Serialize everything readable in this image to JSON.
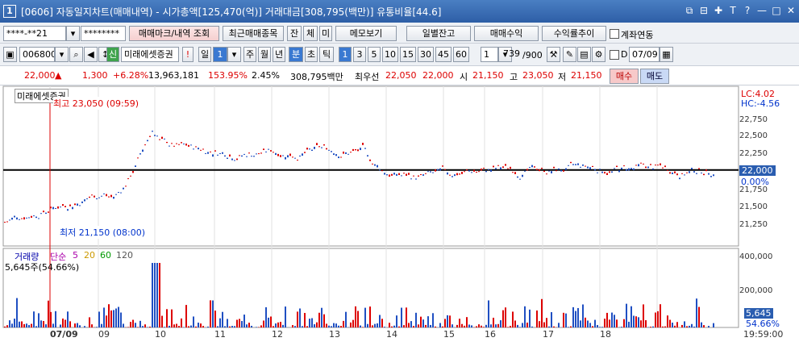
{
  "title": {
    "num": "1",
    "text": "[0606] 자동일지차트(매매내역) - 시가총액[125,470(억)] 거래대금[308,795(백만)] 유통비율[44.6]"
  },
  "toolbar1": {
    "account": "****-**21",
    "password": "********",
    "btn_mark": "매매마크/내역 조회",
    "btn_recent": "최근매매종목",
    "btn_jan": "잔",
    "btn_che": "체",
    "btn_mi": "미",
    "btn_memo": "메모보기",
    "btn_daily": "일별잔고",
    "btn_trade": "매매수익",
    "btn_curve": "수익률추이",
    "chk_link": "계좌연동"
  },
  "toolbar2": {
    "code": "006800",
    "stock": "미래에셋증권",
    "badge": "신",
    "excl": "!",
    "period_day": "일",
    "period_w": "주",
    "period_m": "월",
    "period_y": "년",
    "period_min": "분",
    "period_sec": "초",
    "period_tick": "틱",
    "intervals": [
      "1",
      "3",
      "5",
      "10",
      "15",
      "30",
      "45",
      "60"
    ],
    "interval_val": "1",
    "count": "739",
    "count_total": "/900",
    "date": "07/09",
    "d_label": "D"
  },
  "price": {
    "cur": "22,000",
    "up": "▲",
    "chg": "1,300",
    "pct": "+6.28%",
    "vol": "13,963,181",
    "vol_pct": "153.95%",
    "turn": "2.45%",
    "amount": "308,795백만",
    "best_lbl": "최우선",
    "best_ask": "22,050",
    "best_bid": "22,000",
    "open_lbl": "시",
    "open": "21,150",
    "high_lbl": "고",
    "high": "23,050",
    "low_lbl": "저",
    "low": "21,150",
    "buy": "매수",
    "sell": "매도"
  },
  "chart": {
    "name": "미래에셋증권",
    "high_note": "최고 23,050 (09:59)",
    "low_note": "최저 21,150 (08:00)",
    "lc": "LC:4.02",
    "hc": "HC:-4.56",
    "cur_tag": "22,000",
    "cur_pct": "0.00%",
    "yticks": [
      "22,750",
      "22,500",
      "22,250",
      "21,750",
      "21,500",
      "21,250"
    ]
  },
  "volume": {
    "title": "거래량",
    "ma_lbl": "단순",
    "ma5": "5",
    "ma20": "20",
    "ma60": "60",
    "ma120": "120",
    "info": "5,645주(54.66%)",
    "yticks": [
      "400,000",
      "200,000"
    ],
    "cur_tag": "5,645",
    "cur_pct": "54.66%"
  },
  "xaxis": {
    "labels": [
      "07/09",
      "09",
      "10",
      "11",
      "12",
      "13",
      "14",
      "15",
      "16",
      "17",
      "18"
    ],
    "time": "19:59:00"
  },
  "chart_data": {
    "type": "candlestick",
    "series": "price",
    "ylim": [
      21000,
      23100
    ],
    "y_ref": 22000,
    "x_labels": [
      "07/09",
      "09",
      "10",
      "11",
      "12",
      "13",
      "14",
      "15",
      "16",
      "17",
      "18"
    ],
    "high": 23050,
    "low": 21150,
    "open": 21150,
    "close": 22000
  }
}
